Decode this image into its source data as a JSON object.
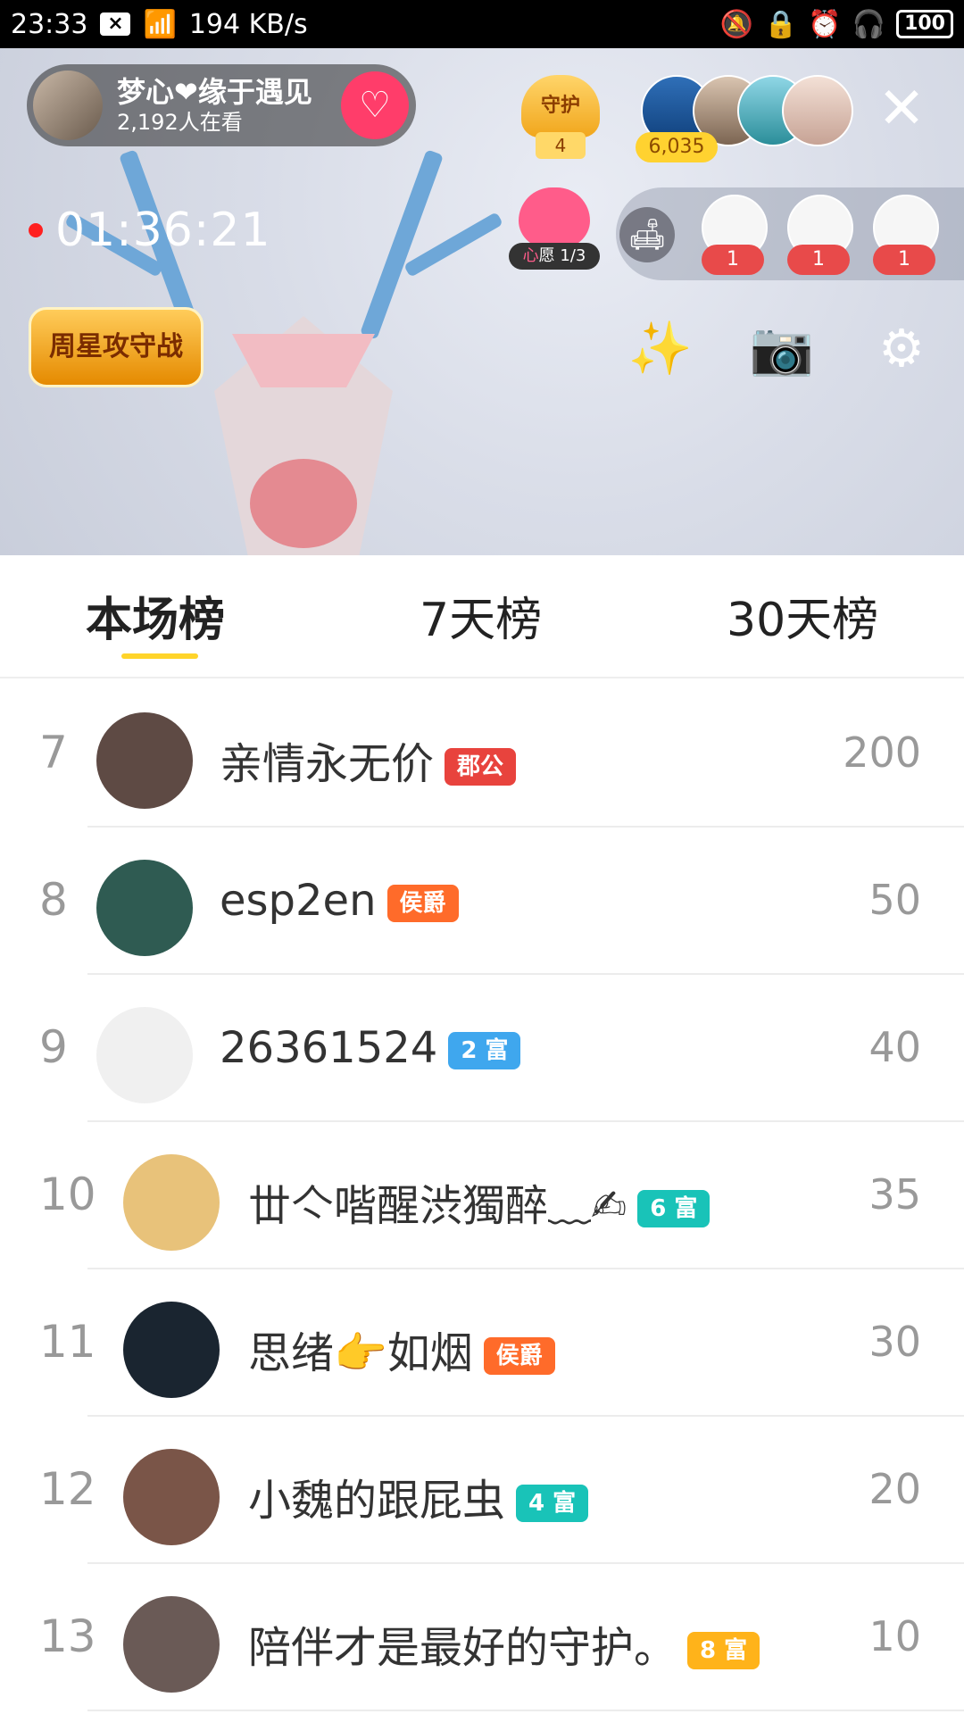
{
  "status_bar": {
    "time": "23:33",
    "x_box": "×",
    "network_speed": "194 KB/s",
    "battery": "100",
    "icons": [
      "mute-icon",
      "lock-icon",
      "alarm-icon",
      "headphones-icon"
    ]
  },
  "live": {
    "anchor_name": "梦心❤缘于遇见",
    "viewers": "2,192人在看",
    "follow_icon": "heart-plus",
    "guard_label": "守护",
    "guard_count": "4",
    "audience_count": "6,035",
    "timer": "01:36:21",
    "wish_label_prefix": "心",
    "wish_label_text": "愿 1/3",
    "seat_counts": [
      "1",
      "1",
      "1"
    ],
    "week_star_label": "周星攻守战",
    "close_symbol": "✕"
  },
  "tabs": [
    {
      "label": "本场榜",
      "active": true
    },
    {
      "label": "7天榜",
      "active": false
    },
    {
      "label": "30天榜",
      "active": false
    }
  ],
  "ranking": [
    {
      "rank": "7",
      "name": "亲情永无价",
      "badge": "郡公",
      "badge_color": "#e8433d",
      "score": "200",
      "avatar_color": "#5e4a44"
    },
    {
      "rank": "8",
      "name": "esp2en",
      "badge": "侯爵",
      "badge_color": "#ff6b2a",
      "score": "50",
      "avatar_color": "#2f5b52"
    },
    {
      "rank": "9",
      "name": "26361524",
      "badge": "2 富",
      "badge_color": "#3fa7ee",
      "score": "40",
      "avatar_color": "#f0f0f0"
    },
    {
      "rank": "10",
      "name": "丗亽喈醒渋獨醉﹏✍",
      "badge": "6 富",
      "badge_color": "#19c3b8",
      "score": "35",
      "avatar_color": "#e8c27a"
    },
    {
      "rank": "11",
      "name": "思绪👉如烟",
      "badge": "侯爵",
      "badge_color": "#ff6b2a",
      "score": "30",
      "avatar_color": "#1a2530"
    },
    {
      "rank": "12",
      "name": "小魏的跟屁虫",
      "badge": "4 富",
      "badge_color": "#19c3b8",
      "score": "20",
      "avatar_color": "#7a5548"
    },
    {
      "rank": "13",
      "name": "陪伴才是最好的守护。",
      "badge": "8 富",
      "badge_color": "#ffb31a",
      "score": "10",
      "avatar_color": "#6a5a56"
    }
  ]
}
